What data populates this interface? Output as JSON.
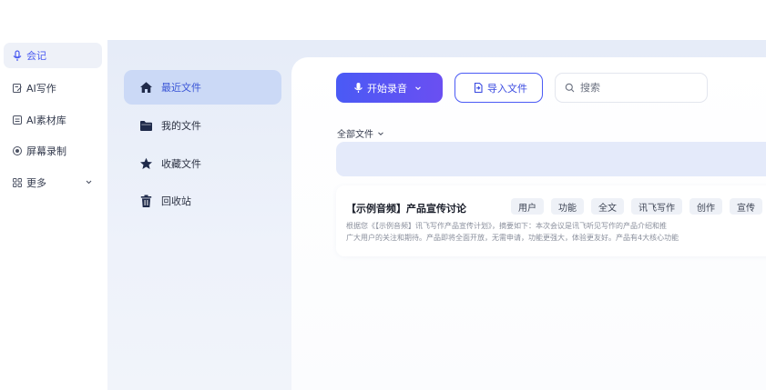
{
  "nav": {
    "items": [
      {
        "label": "会记",
        "icon": "mic-icon",
        "active": true
      },
      {
        "label": "AI写作",
        "icon": "edit-doc-icon"
      },
      {
        "label": "AI素材库",
        "icon": "library-icon"
      },
      {
        "label": "屏幕录制",
        "icon": "record-icon"
      },
      {
        "label": "更多",
        "icon": "grid-icon"
      }
    ]
  },
  "file_sidebar": {
    "items": [
      {
        "label": "最近文件",
        "icon": "home-icon",
        "active": true
      },
      {
        "label": "我的文件",
        "icon": "folder-icon"
      },
      {
        "label": "收藏文件",
        "icon": "star-icon"
      },
      {
        "label": "回收站",
        "icon": "trash-icon"
      }
    ]
  },
  "toolbar": {
    "record_label": "开始录音",
    "import_label": "导入文件",
    "search_placeholder": "搜索"
  },
  "filter": {
    "label": "全部文件"
  },
  "card": {
    "title": "【示例音频】产品宣传讨论",
    "tags": [
      "用户",
      "功能",
      "全文",
      "讯飞写作",
      "创作",
      "宣传"
    ],
    "desc_line1": "根据您《【示例音频】讯飞写作产品宣传计划》，摘要如下：本次会议是讯飞听见写作的产品介绍和推",
    "desc_line2": "广大用户的关注和期待。产品即将全面开放，无需申请，功能更强大，体验更友好。产品有4大核心功能"
  },
  "colors": {
    "accent": "#4a5af5",
    "active_nav_bg": "#eef1f8",
    "active_sidebar_bg": "#cbd9f6",
    "panel_bg": "#e6ecf8"
  }
}
